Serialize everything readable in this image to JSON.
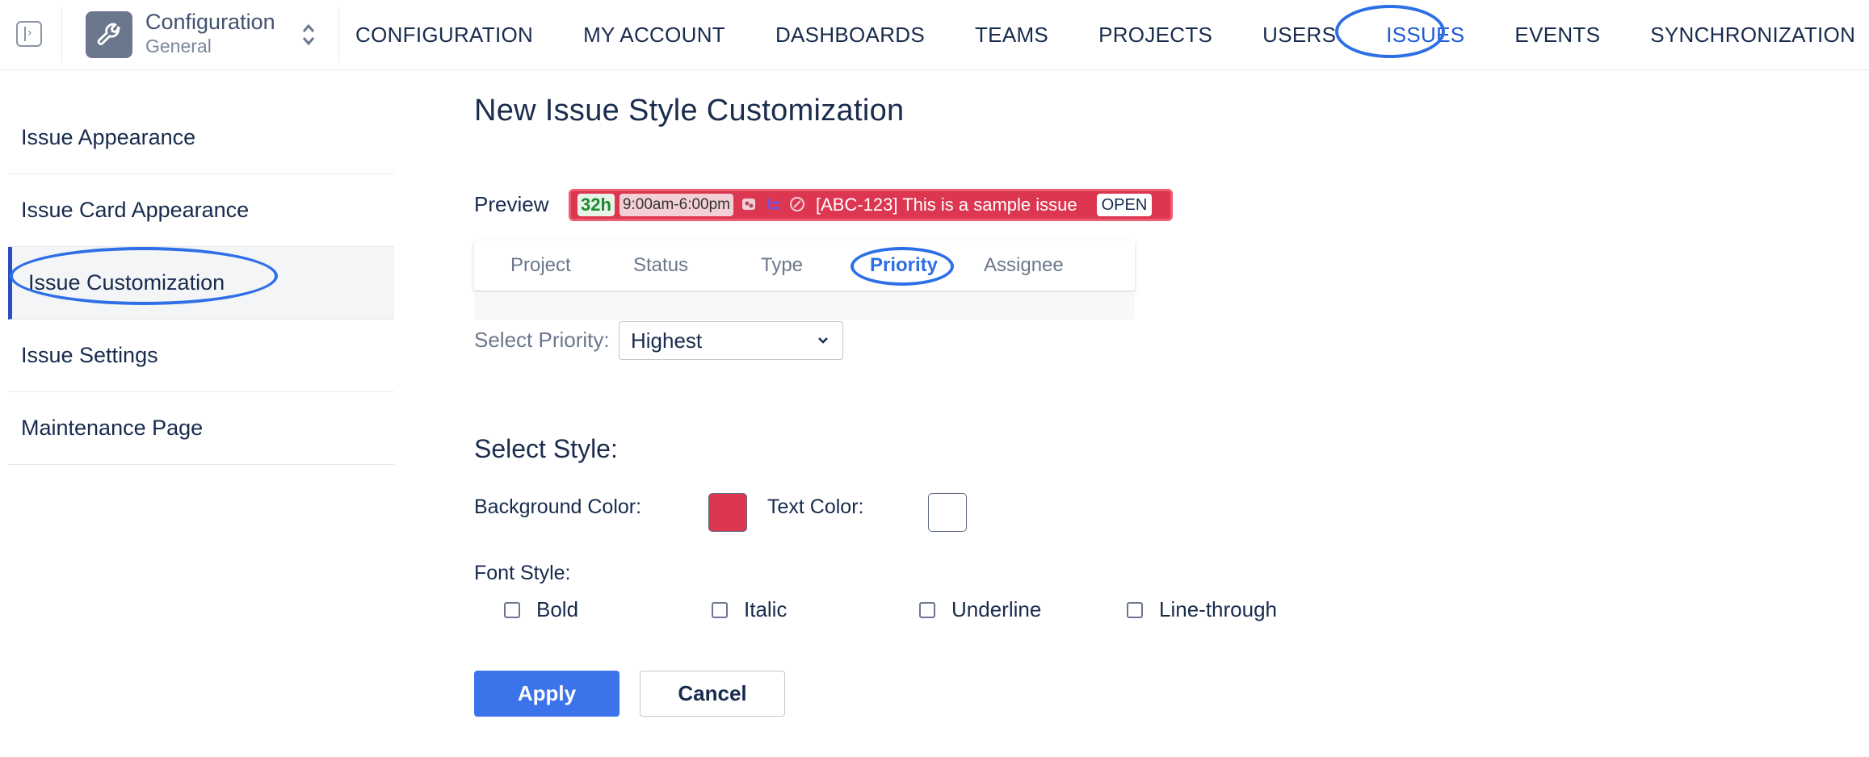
{
  "colors": {
    "accent": "#2d6fe6",
    "primary_button": "#3b73ea",
    "preview_bg": "#dc3651",
    "text_color_swatch": "#ffffff",
    "bg_color_swatch": "#dc3651"
  },
  "header": {
    "collapse_icon": "sidebar-toggle-icon",
    "app_icon": "wrench-icon",
    "app_title": "Configuration",
    "app_subtitle": "General",
    "switcher_icon": "chevron-up-down-icon",
    "nav": [
      {
        "label": "CONFIGURATION",
        "active": false
      },
      {
        "label": "MY ACCOUNT",
        "active": false
      },
      {
        "label": "DASHBOARDS",
        "active": false
      },
      {
        "label": "TEAMS",
        "active": false
      },
      {
        "label": "PROJECTS",
        "active": false
      },
      {
        "label": "USERS",
        "active": false
      },
      {
        "label": "ISSUES",
        "active": true
      },
      {
        "label": "EVENTS",
        "active": false
      },
      {
        "label": "SYNCHRONIZATION",
        "active": false
      }
    ]
  },
  "sidebar": {
    "items": [
      {
        "label": "Issue Appearance",
        "active": false
      },
      {
        "label": "Issue Card Appearance",
        "active": false
      },
      {
        "label": "Issue Customization",
        "active": true
      },
      {
        "label": "Issue Settings",
        "active": false
      },
      {
        "label": "Maintenance Page",
        "active": false
      }
    ]
  },
  "main": {
    "title": "New Issue Style Customization",
    "preview": {
      "label": "Preview",
      "estimate": "32h",
      "time": "9:00am-6:00pm",
      "icons": [
        "group-icon",
        "hierarchy-icon",
        "edit-icon"
      ],
      "issue_text": "[ABC-123] This is a sample issue",
      "status": "OPEN"
    },
    "tabs": [
      {
        "label": "Project",
        "active": false
      },
      {
        "label": "Status",
        "active": false
      },
      {
        "label": "Type",
        "active": false
      },
      {
        "label": "Priority",
        "active": true
      },
      {
        "label": "Assignee",
        "active": false
      }
    ],
    "priority": {
      "label": "Select Priority:",
      "value": "Highest"
    },
    "style": {
      "title": "Select Style:",
      "background_label": "Background Color:",
      "text_label": "Text Color:",
      "font_style_label": "Font Style:",
      "options": [
        {
          "label": "Bold",
          "checked": false
        },
        {
          "label": "Italic",
          "checked": false
        },
        {
          "label": "Underline",
          "checked": false
        },
        {
          "label": "Line-through",
          "checked": false
        }
      ]
    },
    "buttons": {
      "apply": "Apply",
      "cancel": "Cancel"
    }
  }
}
